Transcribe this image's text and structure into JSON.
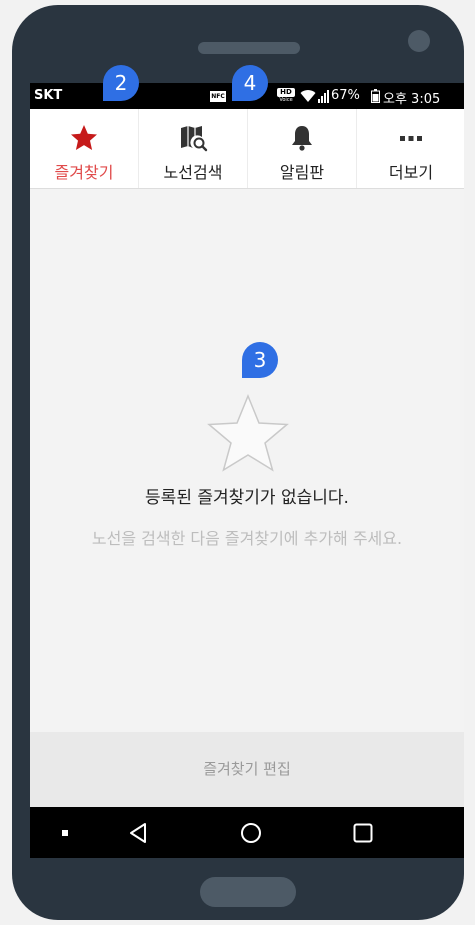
{
  "status_bar": {
    "carrier": "SKT",
    "nfc_label": "NFC",
    "hd_label": "HD",
    "voice_label": "Voice",
    "battery_percent": "67%",
    "time": "오후 3:05"
  },
  "tabs": [
    {
      "label": "즐겨찾기",
      "icon": "star-icon",
      "active": true
    },
    {
      "label": "노선검색",
      "icon": "map-search-icon",
      "active": false
    },
    {
      "label": "알림판",
      "icon": "bell-icon",
      "active": false
    },
    {
      "label": "더보기",
      "icon": "more-icon",
      "active": false
    }
  ],
  "empty_state": {
    "icon": "star-outline-icon",
    "title": "등록된 즐겨찾기가 없습니다.",
    "subtitle": "노선을 검색한 다음 즐겨찾기에 추가해 주세요."
  },
  "edit_bar": {
    "label": "즐겨찾기 편집"
  },
  "markers": [
    {
      "number": "2"
    },
    {
      "number": "4"
    },
    {
      "number": "3"
    }
  ],
  "colors": {
    "accent_red": "#e04a4a",
    "marker_blue": "#2f6fe4",
    "phone_frame": "#2a3540"
  }
}
